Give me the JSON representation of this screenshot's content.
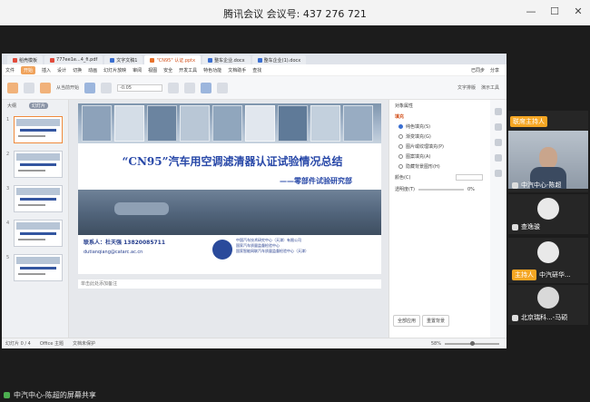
{
  "window": {
    "title": "腾讯会议 会议号: 437 276 721"
  },
  "wps": {
    "tabs": [
      {
        "label": "稻壳模板",
        "color": "#e24b3c"
      },
      {
        "label": "777ee1e...4_fi.pdf",
        "color": "#e24b3c"
      },
      {
        "label": "文字文稿1",
        "color": "#3a6fd1"
      },
      {
        "label": "\"CN95\" 认证.pptx",
        "color": "#e8722c",
        "active": true
      },
      {
        "label": "整车企业.docx",
        "color": "#3a6fd1"
      },
      {
        "label": "整车企业(1).docx",
        "color": "#3a6fd1"
      }
    ],
    "menu": [
      "文件",
      "开始",
      "插入",
      "设计",
      "切换",
      "动画",
      "幻灯片放映",
      "审阅",
      "视图",
      "安全",
      "开发工具",
      "特色功能",
      "文档助手",
      "查找"
    ],
    "menu_right": [
      "已同步",
      "分享"
    ],
    "toolbar": {
      "font_value": "-0.05",
      "slideshow_label": "从当前开始",
      "text_tool_label": "文字排版",
      "present_label": "演示工具"
    },
    "left_pane": {
      "tab_outline": "大纲",
      "tab_slides": "幻灯片",
      "slide_numbers": [
        "1",
        "2",
        "3",
        "4",
        "5"
      ]
    },
    "slide": {
      "title": "“CN95”汽车用空调滤清器认证试验情况总结",
      "subtitle": "——零部件试验研究部",
      "contact": "联系人：杜天强  13820085711",
      "email": "dutianqiang@catarc.ac.cn",
      "org_lines": [
        "中国汽车技术研究中心（天津）有限公司",
        "国家汽车质量监督检验中心",
        "国家智能网联汽车质量监督检验中心（天津）"
      ]
    },
    "notes_placeholder": "单击此处添加备注",
    "props": {
      "header": "对象属性",
      "section": "填充",
      "options": [
        {
          "label": "纯色填充(S)",
          "on": true
        },
        {
          "label": "渐变填充(G)",
          "on": false
        },
        {
          "label": "图片或纹理填充(P)",
          "on": false
        },
        {
          "label": "图案填充(A)",
          "on": false
        },
        {
          "label": "隐藏背景图形(H)",
          "on": false
        }
      ],
      "color_label": "颜色(C)",
      "transparency_label": "透明度(T)",
      "transparency_value": "0%",
      "apply_all": "全部应用",
      "reset": "重置背景"
    },
    "status": {
      "slide_count": "幻灯片 0 / 4",
      "theme": "Office 主题",
      "doc_status": "文档未保护",
      "zoom": "58%"
    }
  },
  "participants": [
    {
      "name": "中汽中心-陈超",
      "role": "联席主持人",
      "type": "video"
    },
    {
      "name": "查逸骏",
      "role": "",
      "type": "avatar"
    },
    {
      "name": "中汽研华...",
      "role": "主持人",
      "type": "avatar"
    },
    {
      "name": "北京瑞科...-马硕",
      "role": "",
      "type": "avatar"
    }
  ],
  "share_status": "中汽中心-陈超的屏幕共享",
  "win_controls": [
    "minimize",
    "maximize",
    "close"
  ]
}
